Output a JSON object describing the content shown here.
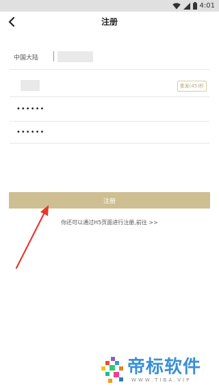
{
  "status_bar": {
    "time": "4:01"
  },
  "header": {
    "title": "注册"
  },
  "form": {
    "region_label": "中国大陆",
    "resend_label": "重发(45)秒",
    "password_mask": "••••••",
    "confirm_password_mask": "••••••"
  },
  "actions": {
    "register_label": "注册",
    "h5_link_text": "你还可以通过H5页面进行注册,前往 >>"
  },
  "watermark": {
    "brand_text": "帝标软件",
    "brand_url": "WWW.TIBA.VIP",
    "brand_color": "#3a8fd6"
  },
  "colors": {
    "accent": "#cebf92",
    "annotation_arrow": "#e8372e"
  }
}
